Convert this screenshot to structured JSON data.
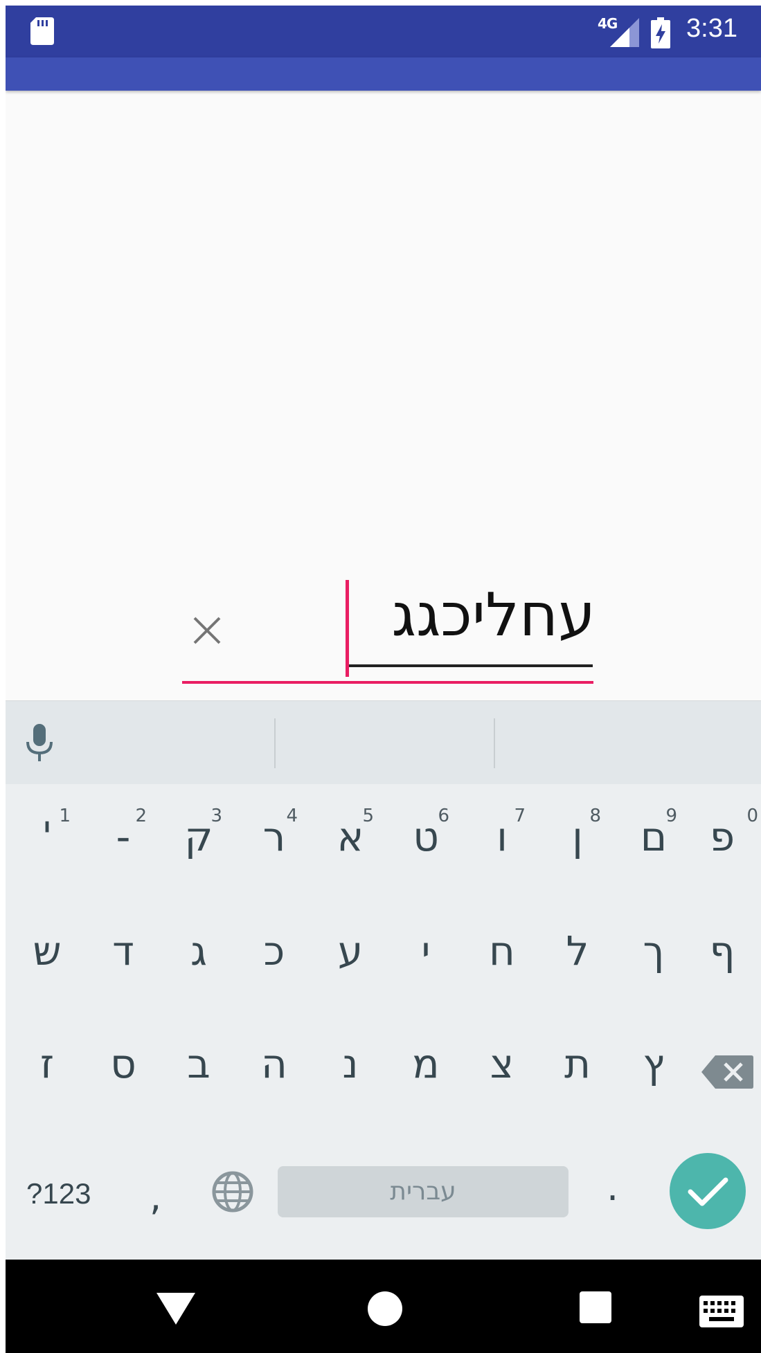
{
  "status_bar": {
    "network": "4G",
    "time": "3:31",
    "icons": [
      "sd-card-icon",
      "signal-icon",
      "battery-charging-icon"
    ]
  },
  "text_field": {
    "value": "עחליכגג"
  },
  "keyboard": {
    "row1": [
      {
        "label": "'",
        "hint": "1"
      },
      {
        "label": "-",
        "hint": "2"
      },
      {
        "label": "ק",
        "hint": "3"
      },
      {
        "label": "ר",
        "hint": "4"
      },
      {
        "label": "א",
        "hint": "5"
      },
      {
        "label": "ט",
        "hint": "6"
      },
      {
        "label": "ו",
        "hint": "7"
      },
      {
        "label": "ן",
        "hint": "8"
      },
      {
        "label": "ם",
        "hint": "9"
      },
      {
        "label": "פ",
        "hint": "0"
      }
    ],
    "row2": [
      "ש",
      "ד",
      "ג",
      "כ",
      "ע",
      "י",
      "ח",
      "ל",
      "ך",
      "ף"
    ],
    "row3": [
      "ז",
      "ס",
      "ב",
      "ה",
      "נ",
      "מ",
      "צ",
      "ת",
      "ץ"
    ],
    "mode_label": "?123",
    "comma": ",",
    "space_label": "עברית",
    "period": ".",
    "colors": {
      "background": "#eceff1",
      "enter": "#4db6ac",
      "accent": "#e91e63",
      "statusbar": "#303f9f",
      "appbar": "#3f51b5"
    }
  }
}
